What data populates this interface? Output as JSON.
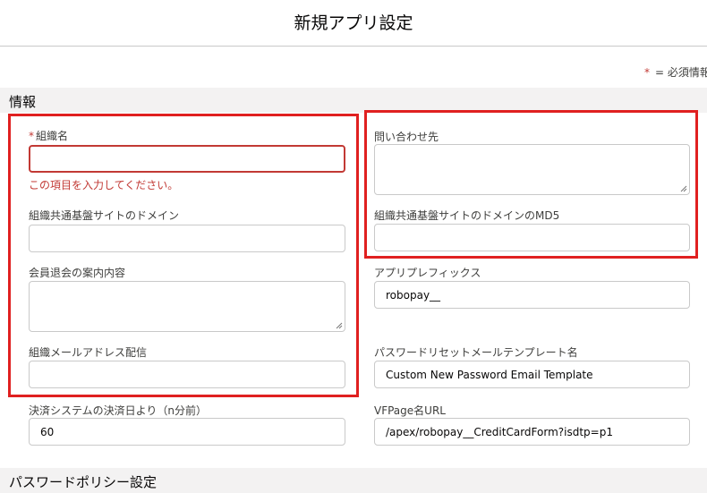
{
  "header": {
    "title": "新規アプリ設定"
  },
  "legend": {
    "star": "*",
    "text": "= 必須情報"
  },
  "sections": {
    "info": "情報",
    "password_policy": "パスワードポリシー設定"
  },
  "fields": {
    "org_name": {
      "label": "組織名",
      "required_star": "*",
      "value": "",
      "error": "この項目を入力してください。"
    },
    "domain": {
      "label": "組織共通基盤サイトのドメイン",
      "value": ""
    },
    "withdrawal": {
      "label": "会員退会の案内内容",
      "value": ""
    },
    "mail_delivery": {
      "label": "組織メールアドレス配信",
      "value": ""
    },
    "settlement_days": {
      "label": "決済システムの決済日より（n分前）",
      "value": "60"
    },
    "contact": {
      "label": "問い合わせ先",
      "value": ""
    },
    "domain_md5": {
      "label": "組織共通基盤サイトのドメインのMD5",
      "value": ""
    },
    "app_prefix": {
      "label": "アプリプレフィックス",
      "value": "robopay__"
    },
    "pw_template": {
      "label": "パスワードリセットメールテンプレート名",
      "value": "Custom New Password Email Template"
    },
    "vfpage_url": {
      "label": "VFPage名URL",
      "value": "/apex/robopay__CreditCardForm?isdtp=p1"
    }
  },
  "colors": {
    "highlight": "#e02020",
    "error": "#c23934",
    "section_bg": "#f3f2f2",
    "border": "#c9c9c9"
  }
}
